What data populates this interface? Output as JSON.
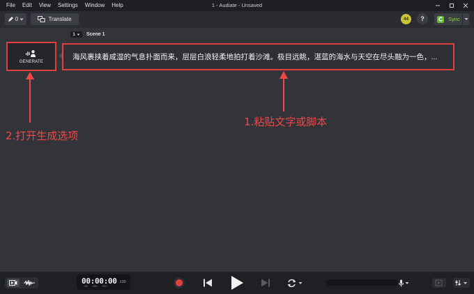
{
  "menu": {
    "items": [
      "File",
      "Edit",
      "View",
      "Settings",
      "Window",
      "Help"
    ]
  },
  "window": {
    "title": "1 - Audiate - Unsaved",
    "controls": [
      "minimize-icon",
      "maximize-icon",
      "close-icon"
    ]
  },
  "toolbar": {
    "edit_count": "0",
    "translate_label": "Translate",
    "avatar_initials": "44",
    "help_label": "?",
    "sync_label": "Sync"
  },
  "scene": {
    "number": "1",
    "label": "Scene 1"
  },
  "generate": {
    "label": "GENERATE"
  },
  "script": {
    "text": "海风裹挟着咸湿的气息扑面而来，层层白浪轻柔地拍打着沙滩。极目远眺，湛蓝的海水与天空在尽头融为一色，..."
  },
  "annotations": {
    "paste_hint": "1.粘贴文字或脚本",
    "generate_hint": "2.打开生成选项"
  },
  "transport": {
    "timecode": "00:00:00",
    "timecode_fraction": ".100",
    "timecode_units": "HR MIN SEC"
  },
  "colors": {
    "accent_red": "#e0403e",
    "annotation_red": "#f04848",
    "sync_green": "#9ad24a",
    "avatar_yellow": "#c9c43a"
  }
}
